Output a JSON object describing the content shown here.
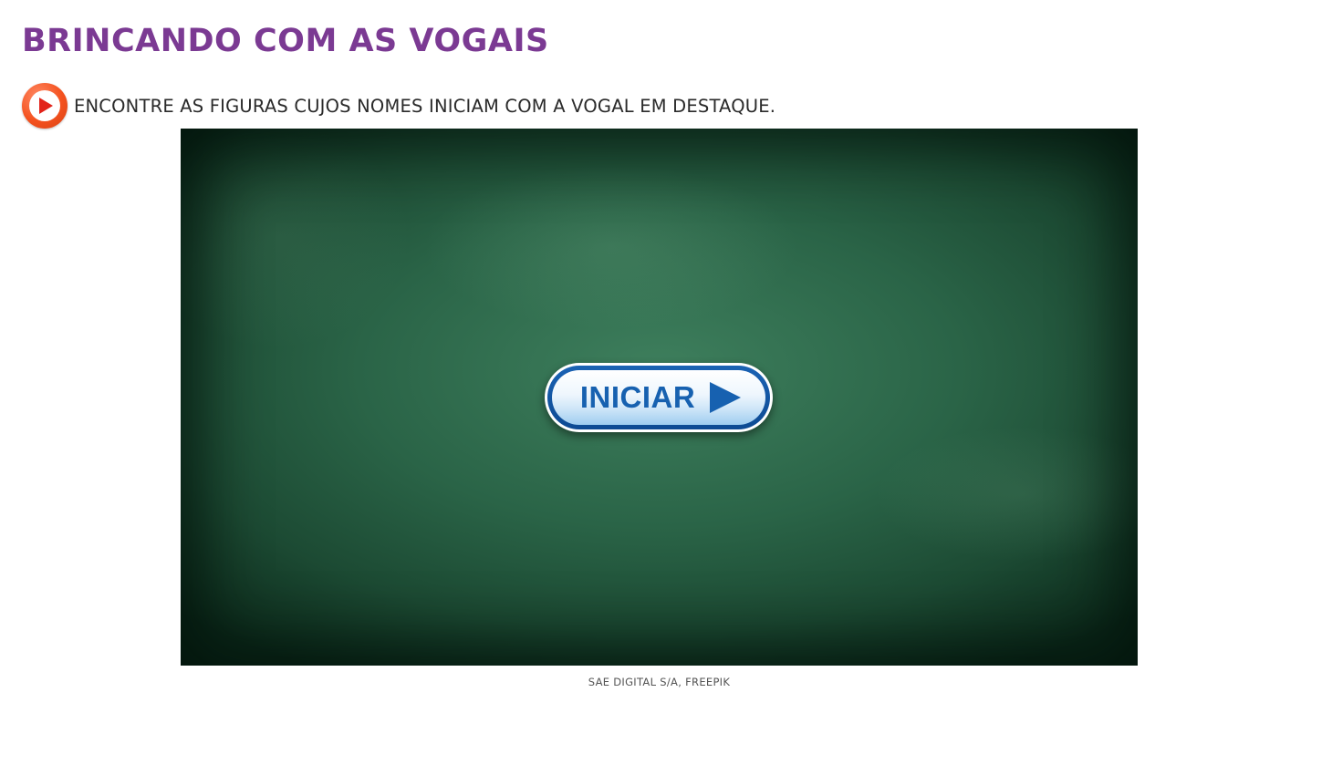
{
  "page": {
    "title": "BRINCANDO COM AS VOGAIS",
    "instruction": "ENCONTRE AS FIGURAS CUJOS NOMES INICIAM COM A VOGAL EM DESTAQUE.",
    "audio_button_icon": "play-audio-icon"
  },
  "game": {
    "background": "green-chalkboard",
    "start_button_label": "INICIAR",
    "start_button_icon": "play-arrow-icon"
  },
  "credit": "SAE DIGITAL S/A, FREEPIK",
  "colors": {
    "title": "#7b3a93",
    "audio_button": "#f4511e",
    "start_button_text": "#1761b0",
    "chalkboard": "#2a6447"
  }
}
